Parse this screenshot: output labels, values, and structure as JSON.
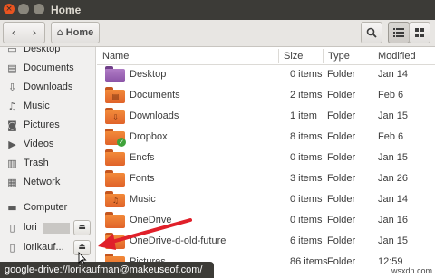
{
  "window": {
    "title": "Home"
  },
  "toolbar": {
    "back_icon": "chevron-left-icon",
    "forward_icon": "chevron-right-icon",
    "home_label": "Home",
    "search_icon": "search-icon",
    "list_view_icon": "list-view-icon",
    "grid_view_icon": "grid-view-icon"
  },
  "sidebar": {
    "items": [
      {
        "label": "Desktop",
        "icon": "desktop-icon",
        "glyph": "▭"
      },
      {
        "label": "Documents",
        "icon": "document-icon",
        "glyph": "▤"
      },
      {
        "label": "Downloads",
        "icon": "download-icon",
        "glyph": "⇩"
      },
      {
        "label": "Music",
        "icon": "music-icon",
        "glyph": "♫"
      },
      {
        "label": "Pictures",
        "icon": "camera-icon",
        "glyph": "◙"
      },
      {
        "label": "Videos",
        "icon": "video-icon",
        "glyph": "▶"
      },
      {
        "label": "Trash",
        "icon": "trash-icon",
        "glyph": "▥"
      },
      {
        "label": "Network",
        "icon": "network-icon",
        "glyph": "▦"
      },
      {
        "label": "Computer",
        "icon": "computer-icon",
        "glyph": "▬"
      },
      {
        "label": "lori",
        "icon": "drive-icon",
        "glyph": "▯"
      },
      {
        "label": "lorikauf...",
        "icon": "drive-icon",
        "glyph": "▯"
      }
    ],
    "eject_icon": "eject-icon"
  },
  "columns": {
    "name": "Name",
    "size": "Size",
    "type": "Type",
    "modified": "Modified"
  },
  "files": [
    {
      "name": "Desktop",
      "size": "0 items",
      "type": "Folder",
      "modified": "Jan 14",
      "emblem": "",
      "style": "desktop"
    },
    {
      "name": "Documents",
      "size": "2 items",
      "type": "Folder",
      "modified": "Feb 6",
      "emblem": "▤",
      "style": ""
    },
    {
      "name": "Downloads",
      "size": "1 item",
      "type": "Folder",
      "modified": "Jan 15",
      "emblem": "⇩",
      "style": ""
    },
    {
      "name": "Dropbox",
      "size": "8 items",
      "type": "Folder",
      "modified": "Feb 6",
      "emblem": "",
      "style": "dropbox"
    },
    {
      "name": "Encfs",
      "size": "0 items",
      "type": "Folder",
      "modified": "Jan 15",
      "emblem": "",
      "style": ""
    },
    {
      "name": "Fonts",
      "size": "3 items",
      "type": "Folder",
      "modified": "Jan 26",
      "emblem": "",
      "style": ""
    },
    {
      "name": "Music",
      "size": "0 items",
      "type": "Folder",
      "modified": "Jan 14",
      "emblem": "♫",
      "style": ""
    },
    {
      "name": "OneDrive",
      "size": "0 items",
      "type": "Folder",
      "modified": "Jan 16",
      "emblem": "",
      "style": ""
    },
    {
      "name": "OneDrive-d-old-future",
      "size": "6 items",
      "type": "Folder",
      "modified": "Jan 15",
      "emblem": "",
      "style": ""
    },
    {
      "name": "Pictures",
      "size": "86 items",
      "type": "Folder",
      "modified": "12:59",
      "emblem": "",
      "style": ""
    }
  ],
  "statusbar": {
    "text": "google-drive://lorikaufman@makeuseof.com/"
  },
  "watermark": "wsxdn.com",
  "colors": {
    "accent": "#e95420",
    "folder": "#ef7a33",
    "arrow": "#e0202a",
    "titlebar": "#3c3b37"
  }
}
